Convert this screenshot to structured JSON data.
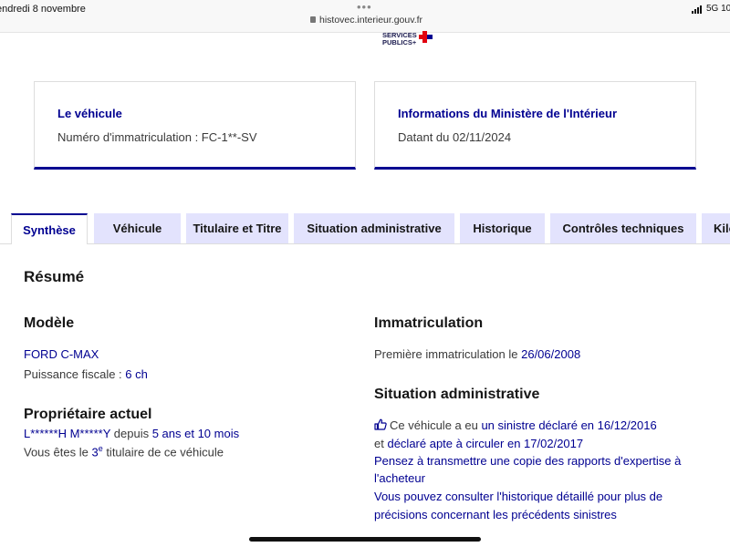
{
  "status_bar": {
    "date": "endredi 8 novembre",
    "dots": "•••",
    "url": "histovec.interieur.gouv.fr",
    "network": "5G",
    "battery": "10"
  },
  "logo": {
    "line1": "SERVICES",
    "line2": "PUBLICS+"
  },
  "cards": {
    "vehicle": {
      "title": "Le véhicule",
      "text": "Numéro d'immatriculation : FC-1**-SV"
    },
    "ministry": {
      "title": "Informations du Ministère de l'Intérieur",
      "text": "Datant du 02/11/2024"
    }
  },
  "tabs": [
    {
      "label": "Synthèse"
    },
    {
      "label": "Véhicule"
    },
    {
      "label": "Titulaire et Titre"
    },
    {
      "label": "Situation administrative"
    },
    {
      "label": "Historique"
    },
    {
      "label": "Contrôles techniques"
    },
    {
      "label": "Kilo"
    }
  ],
  "summary": {
    "title": "Résumé",
    "model": {
      "heading": "Modèle",
      "name": "FORD C-MAX",
      "power_label": "Puissance fiscale : ",
      "power_value": "6 ch"
    },
    "owner": {
      "heading": "Propriétaire actuel",
      "name": "L******H M*****Y",
      "since_label": " depuis ",
      "since_value": "5 ans et 10 mois",
      "rank_prefix": "Vous êtes le ",
      "rank_value": "3",
      "rank_sup": "e",
      "rank_suffix": " titulaire de ce véhicule"
    },
    "registration": {
      "heading": "Immatriculation",
      "label": "Première immatriculation le ",
      "date": "26/06/2008"
    },
    "admin": {
      "heading": "Situation administrative",
      "line1_prefix": "Ce véhicule a eu ",
      "line1_link": "un sinistre déclaré en 16/12/2016",
      "line2_prefix": "et ",
      "line2_link": "déclaré apte à circuler en 17/02/2017",
      "line3": "Pensez à transmettre une copie des rapports d'expertise à",
      "line4": "l'acheteur",
      "line5": "Vous pouvez consulter l'historique détaillé pour plus de",
      "line6": "précisions concernant les précédents sinistres"
    }
  },
  "colors": {
    "brand_blue": "#000091",
    "tab_bg": "#e3e3fd",
    "text": "#3a3a3a"
  }
}
